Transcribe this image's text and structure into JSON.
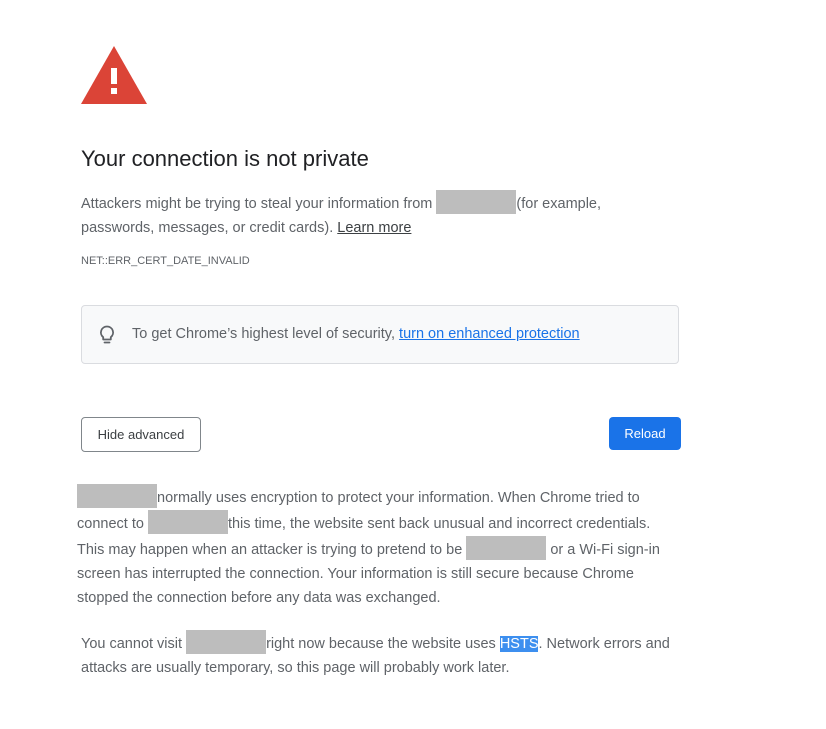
{
  "title": "Your connection is not private",
  "intro": {
    "before_site": "Attackers might be trying to steal your information from ",
    "after_site": "(for example, passwords, messages, or credit cards).",
    "learn_more": "Learn more"
  },
  "error_code": "NET::ERR_CERT_DATE_INVALID",
  "enhanced_protection": {
    "icon": "lightbulb-icon",
    "text": "To get Chrome’s highest level of security, ",
    "link": "turn on enhanced protection"
  },
  "buttons": {
    "hide_advanced": "Hide advanced",
    "reload": "Reload"
  },
  "details": {
    "p1_part1": "normally uses encryption to protect your information. When Chrome tried to connect to ",
    "p1_part2": "this time, the website sent back unusual and incorrect credentials. This may happen when an attacker is trying to pretend to be ",
    "p1_part3": " or a Wi-Fi sign-in screen has interrupted the connection. Your information is still secure because Chrome stopped the connection before any data was exchanged.",
    "p2_part1": "You cannot visit ",
    "p2_part2": "right now because the website uses ",
    "hsts": "HSTS",
    "p2_part3": ". Network errors and attacks are usually temporary, so this page will probably work later."
  },
  "colors": {
    "warning_red": "#db4437",
    "reload_blue": "#1a73e8",
    "link_blue": "#1a73e8",
    "selection_blue": "#3d8fef",
    "redaction_gray": "#bdbdbd"
  }
}
